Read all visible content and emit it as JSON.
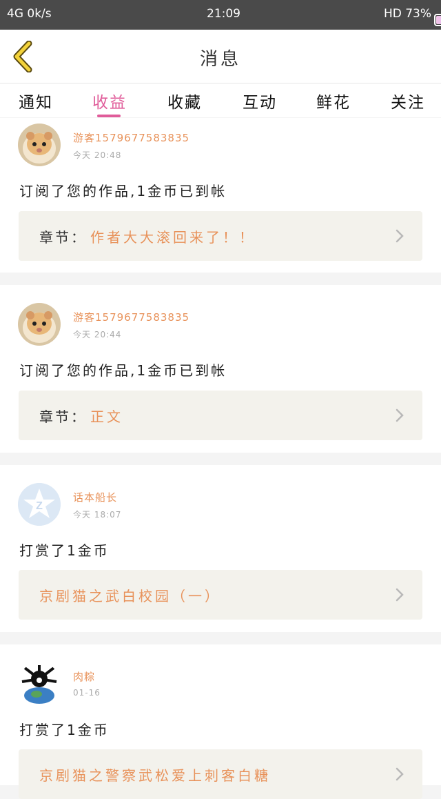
{
  "status_bar": {
    "left": "4G 0k/s",
    "time": "21:09",
    "right": "HD 73%"
  },
  "header": {
    "title": "消息"
  },
  "tabs": [
    {
      "label": "通知",
      "active": false
    },
    {
      "label": "收益",
      "active": true
    },
    {
      "label": "收藏",
      "active": false
    },
    {
      "label": "互动",
      "active": false
    },
    {
      "label": "鲜花",
      "active": false
    },
    {
      "label": "关注",
      "active": false
    }
  ],
  "messages": [
    {
      "username": "游客1579677583835",
      "time": "今天 20:48",
      "text": "订阅了您的作品,1金币已到帐",
      "ref_label": "章节：",
      "ref_text": "作者大大滚回来了！！",
      "avatar": "hamster-avatar"
    },
    {
      "username": "游客1579677583835",
      "time": "今天 20:44",
      "text": "订阅了您的作品,1金币已到帐",
      "ref_label": "章节：",
      "ref_text": "正文",
      "avatar": "hamster-avatar"
    },
    {
      "username": "话本船长",
      "time": "今天 18:07",
      "text": "打赏了1金币",
      "ref_label": "",
      "ref_text": "京剧猫之武白校园（一）",
      "avatar": "default-z-avatar"
    },
    {
      "username": "肉粽",
      "time": "01-16",
      "text": "打赏了1金币",
      "ref_label": "",
      "ref_text": "京剧猫之警察武松爱上刺客白糖",
      "avatar": "black-figure-avatar"
    }
  ],
  "colors": {
    "accent": "#e05c9a",
    "orange_text": "#e8925a",
    "status_bar": "#4a4a4a",
    "ref_box": "#f3f2ec"
  }
}
